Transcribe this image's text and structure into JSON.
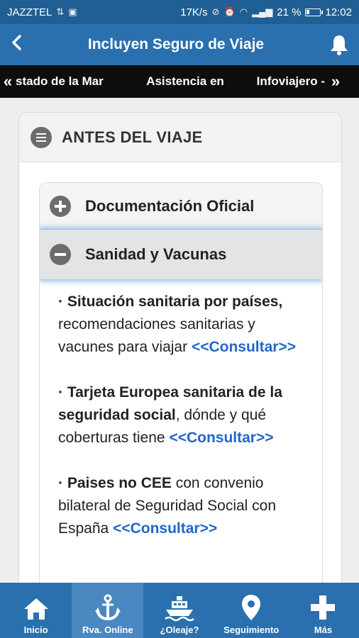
{
  "status_bar": {
    "carrier": "JAZZTEL",
    "speed": "17K/s",
    "battery": "21 %",
    "battery_level": 0.21,
    "time": "12:02"
  },
  "app_bar": {
    "title": "Incluyen Seguro de Viaje",
    "back_icon": "chevron-left-icon",
    "bell_icon": "bell-icon"
  },
  "ticker": {
    "left_arrow": "«",
    "right_arrow": "»",
    "items": [
      "stado de la Mar",
      "Asistencia en",
      "Infoviajero -"
    ]
  },
  "section": {
    "title": "ANTES DEL VIAJE"
  },
  "accordion": {
    "items": [
      {
        "label": "Documentación Oficial",
        "state": "collapsed"
      },
      {
        "label": "Sanidad y Vacunas",
        "state": "expanded"
      }
    ]
  },
  "content": {
    "p1_bold": "· Situación sanitaria por países,",
    "p1_text": " recomendaciones sanitarias y vacunes para viajar ",
    "p1_link": "<<Consultar>>",
    "p2_bold": "· Tarjeta Europea sanitaria de la seguridad social",
    "p2_text": ", dónde y qué coberturas tiene ",
    "p2_link": "<<Consultar>>",
    "p3_bold": "· Paises no CEE",
    "p3_text": " con convenio bilateral de Seguridad Social con España  ",
    "p3_link": "<<Consultar>>"
  },
  "bottom_nav": {
    "items": [
      {
        "label": "Inicio",
        "icon": "home-icon"
      },
      {
        "label": "Rva. Online",
        "icon": "anchor-icon"
      },
      {
        "label": "¿Oleaje?",
        "icon": "ship-icon"
      },
      {
        "label": "Seguimiento",
        "icon": "location-pin-icon"
      },
      {
        "label": "Más",
        "icon": "plus-icon"
      }
    ],
    "active_index": 1
  },
  "colors": {
    "status_bar": "#1f5f93",
    "app_bar": "#2a6fae",
    "ticker": "#0e0e0e",
    "link": "#2266cc",
    "nav_active": "#4a88c2"
  }
}
